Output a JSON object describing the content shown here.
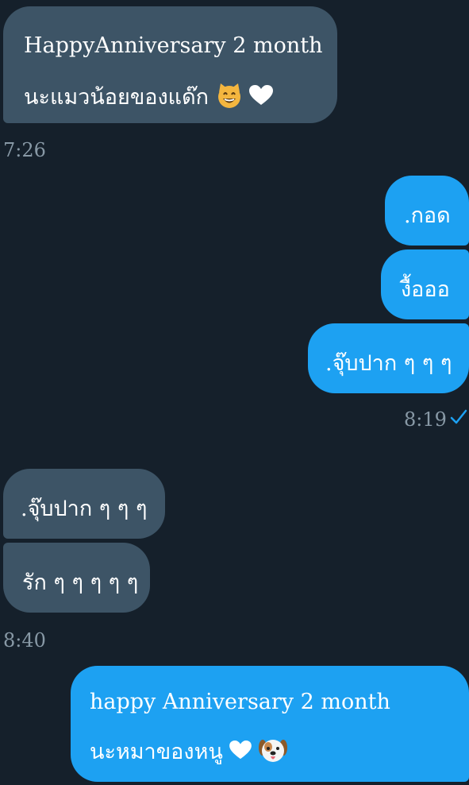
{
  "messages": [
    {
      "direction": "incoming",
      "lines": [
        "HappyAnniversary  2  month",
        "นะแมวน้อยของแด๊ก"
      ],
      "emoji": [
        "cat-face-icon",
        "heart-icon"
      ]
    },
    {
      "direction": "incoming",
      "timestamp": "7:26"
    },
    {
      "direction": "outgoing",
      "text": ".กอด"
    },
    {
      "direction": "outgoing",
      "text": "งื้อออ"
    },
    {
      "direction": "outgoing",
      "text": ".จุ๊บปาก ๆ ๆ ๆ"
    },
    {
      "direction": "outgoing",
      "timestamp": "8:19",
      "status": "read-check-icon"
    },
    {
      "direction": "incoming",
      "text": ".จุ๊บปาก ๆ ๆ ๆ"
    },
    {
      "direction": "incoming",
      "text": "รัก ๆ ๆ ๆ ๆ ๆ"
    },
    {
      "direction": "incoming",
      "timestamp": "8:40"
    },
    {
      "direction": "outgoing",
      "lines": [
        "happy  Anniversary  2  month",
        "นะหมาของหนู"
      ],
      "emoji": [
        "heart-icon",
        "dog-face-icon"
      ]
    }
  ],
  "colors": {
    "background": "#15202b",
    "incoming_bubble": "#3d5466",
    "outgoing_bubble": "#1da1f2",
    "timestamp": "#8899a6",
    "check": "#1da1f2"
  }
}
